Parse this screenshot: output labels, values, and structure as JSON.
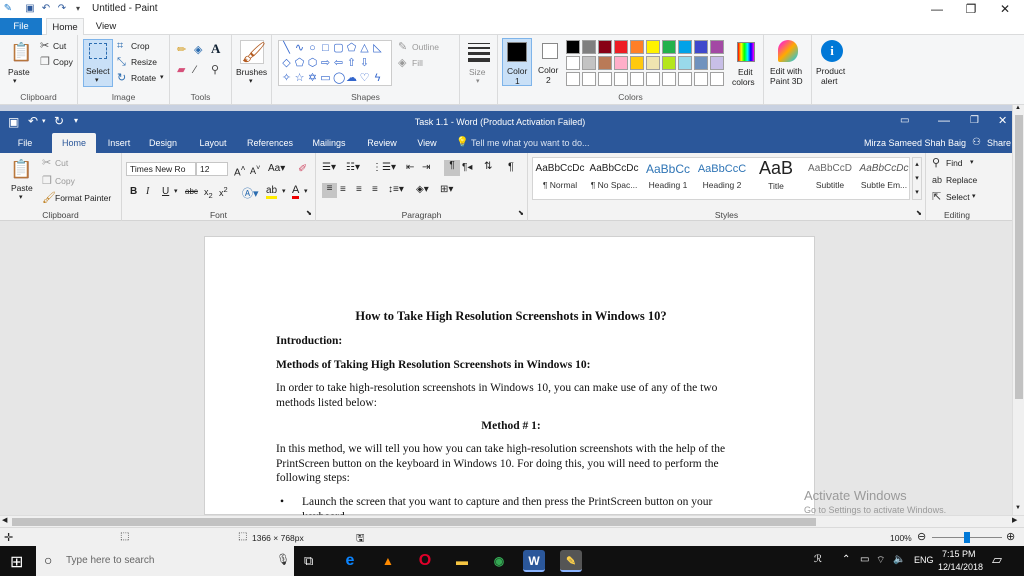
{
  "paint": {
    "title": "Untitled - Paint",
    "tabs": {
      "file": "File",
      "home": "Home",
      "view": "View"
    },
    "clipboard": {
      "paste": "Paste",
      "cut": "Cut",
      "copy": "Copy",
      "group": "Clipboard"
    },
    "image": {
      "select": "Select",
      "crop": "Crop",
      "resize": "Resize",
      "rotate": "Rotate",
      "group": "Image"
    },
    "tools": {
      "group": "Tools"
    },
    "brushes": "Brushes",
    "shapes": {
      "outline": "Outline",
      "fill": "Fill",
      "group": "Shapes"
    },
    "size": "Size",
    "color1": [
      "Color",
      "1"
    ],
    "color2": [
      "Color",
      "2"
    ],
    "edit_colors": [
      "Edit",
      "colors"
    ],
    "edit_paint3d": [
      "Edit with",
      "Paint 3D"
    ],
    "product_alert": [
      "Product",
      "alert"
    ],
    "colors_group": "Colors",
    "palette_row1": [
      "#000000",
      "#7f7f7f",
      "#880015",
      "#ed1c24",
      "#ff7f27",
      "#fff200",
      "#22b14c",
      "#00a2e8",
      "#3f48cc",
      "#a349a4"
    ],
    "palette_row2": [
      "#ffffff",
      "#c3c3c3",
      "#b97a57",
      "#ffaec9",
      "#ffc90e",
      "#efe4b0",
      "#b5e61d",
      "#99d9ea",
      "#7092be",
      "#c8bfe7"
    ],
    "status_size": "1366 × 768px",
    "zoom": "100%",
    "zoom_fraction": 0.5
  },
  "word": {
    "title": "Task 1.1 - Word (Product Activation Failed)",
    "user": "Mirza Sameed Shah Baig",
    "share": "Share",
    "tell_me": "Tell me what you want to do...",
    "tabs": [
      "File",
      "Home",
      "Insert",
      "Design",
      "Layout",
      "References",
      "Mailings",
      "Review",
      "View"
    ],
    "clipboard": {
      "paste": "Paste",
      "cut": "Cut",
      "copy": "Copy",
      "format_painter": "Format Painter",
      "group": "Clipboard"
    },
    "font": {
      "name": "Times New Ro",
      "size": "12",
      "group": "Font",
      "bold": "B",
      "italic": "I",
      "underline": "U"
    },
    "paragraph_group": "Paragraph",
    "styles": [
      {
        "sample": "AaBbCcDc",
        "name": "¶ Normal"
      },
      {
        "sample": "AaBbCcDc",
        "name": "¶ No Spac..."
      },
      {
        "sample": "AaBbCc",
        "name": "Heading 1"
      },
      {
        "sample": "AaBbCcC",
        "name": "Heading 2"
      },
      {
        "sample": "AaB",
        "name": "Title"
      },
      {
        "sample": "AaBbCcD",
        "name": "Subtitle"
      },
      {
        "sample": "AaBbCcDc",
        "name": "Subtle Em..."
      }
    ],
    "styles_group": "Styles",
    "editing": {
      "find": "Find",
      "replace": "Replace",
      "select": "Select",
      "group": "Editing"
    },
    "document": {
      "title": "How to Take High Resolution Screenshots in Windows 10?",
      "intro": "Introduction:",
      "methods": "Methods of Taking High Resolution Screenshots in Windows 10:",
      "para1": "In order to take high-resolution screenshots in Windows 10, you can make use of any of the two methods listed below:",
      "method1": "Method # 1:",
      "para2": "In this method, we will tell you how you can take high-resolution screenshots with the help of the PrintScreen button on the keyboard in Windows 10. For doing this, you will need to perform the following steps:",
      "bullet1": "Launch the screen that you want to capture and then press the PrintScreen button on your keyboard."
    }
  },
  "watermark": {
    "line1": "Activate Windows",
    "line2": "Go to Settings to activate Windows."
  },
  "taskbar": {
    "search": "Type here to search",
    "language": "ENG",
    "time": "7:15 PM",
    "date": "12/14/2018"
  }
}
